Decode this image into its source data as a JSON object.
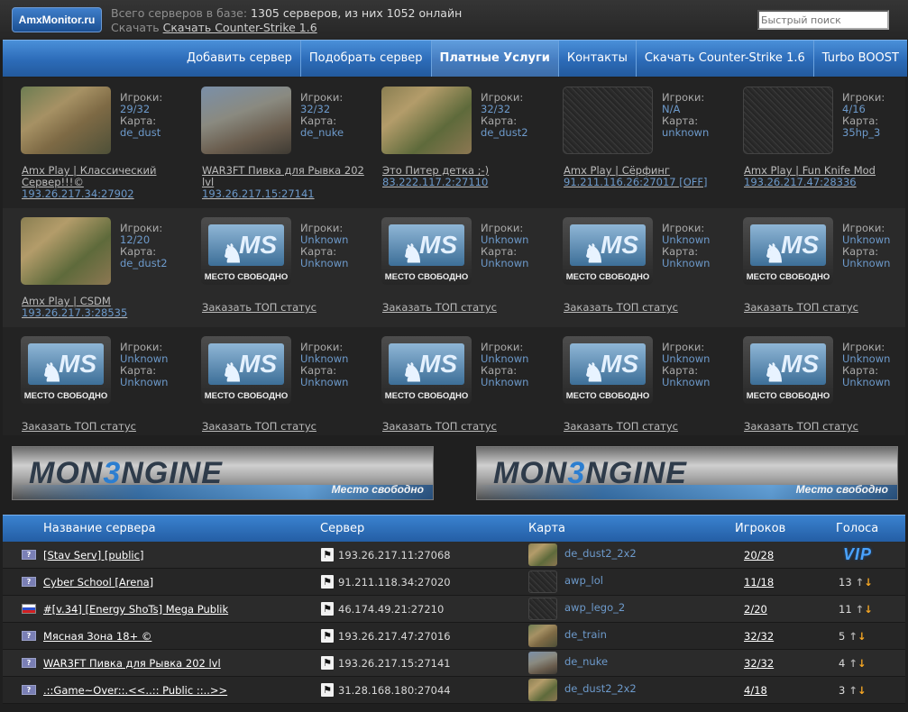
{
  "header": {
    "logo": "AmxMonitor.ru",
    "stats_prefix": "Всего серверов в базе:",
    "stats_value": "1305 серверов, из них 1052 онлайн",
    "download_prefix": "Скачать",
    "download_link": "Скачать Counter-Strike 1.6",
    "search_placeholder": "Быстрый поиск"
  },
  "nav": [
    "Добавить сервер",
    "Подобрать сервер",
    "Платные Услуги",
    "Контакты",
    "Скачать Counter-Strike 1.6",
    "Turbo BOOST"
  ],
  "labels": {
    "players": "Игроки:",
    "map": "Карта:",
    "free_slot": "МЕСТО СВОБОДНО",
    "order_top": "Заказать ТОП статус"
  },
  "top_servers": [
    {
      "players": "29/32",
      "map": "de_dust",
      "name": "Amx Play | Классический Сервер!!!©",
      "addr": "193.26.217.34:27902",
      "thumb": "map"
    },
    {
      "players": "32/32",
      "map": "de_nuke",
      "name": "WAR3FT Пивка для Рывка 202 lvl",
      "addr": "193.26.217.15:27141",
      "thumb": "nuke"
    },
    {
      "players": "32/32",
      "map": "de_dust2",
      "name": "Это Питер детка ;-)",
      "addr": "83.222.117.2:27110",
      "thumb": "dust"
    },
    {
      "players": "N/A",
      "map": "unknown",
      "name": "Amx Play | Сёрфинг",
      "addr": "91.211.116.26:27017 [OFF]",
      "thumb": "noise"
    },
    {
      "players": "4/16",
      "map": "35hp_3",
      "name": "Amx Play | Fun Knife Mod",
      "addr": "193.26.217.47:28336",
      "thumb": "noise"
    },
    {
      "players": "12/20",
      "map": "de_dust2",
      "name": "Amx Play | CSDM",
      "addr": "193.26.217.3:28535",
      "thumb": "dust"
    }
  ],
  "free_values": {
    "players": "Unknown",
    "map": "Unknown"
  },
  "banners": {
    "word_a": "MON",
    "word_b": "3",
    "word_c": "NGINE",
    "free": "Место свободно"
  },
  "table": {
    "headers": {
      "name": "Название сервера",
      "server": "Сервер",
      "map": "Карта",
      "players": "Игроков",
      "votes": "Голоса"
    },
    "rows": [
      {
        "flag": "?",
        "name": "[Stav Serv] [public]",
        "server": "193.26.217.11:27068",
        "map": "de_dust2_2x2",
        "players": "20/28",
        "votes": "VIP"
      },
      {
        "flag": "?",
        "name": "Cyber School [Arena]",
        "server": "91.211.118.34:27020",
        "map": "awp_lol",
        "players": "11/18",
        "votes": "13"
      },
      {
        "flag": "ru",
        "name": "#[v.34] [Energy ShoTs] Mega Publik",
        "server": "46.174.49.21:27210",
        "map": "awp_lego_2",
        "players": "2/20",
        "votes": "11"
      },
      {
        "flag": "?",
        "name": "Мясная Зона 18+ ©",
        "server": "193.26.217.47:27016",
        "map": "de_train",
        "players": "32/32",
        "votes": "5"
      },
      {
        "flag": "?",
        "name": "WAR3FT Пивка для Рывка 202 lvl",
        "server": "193.26.217.15:27141",
        "map": "de_nuke",
        "players": "32/32",
        "votes": "4"
      },
      {
        "flag": "?",
        "name": ".::Game~Over::.<<..:: Public ::..>>",
        "server": "31.28.168.180:27044",
        "map": "de_dust2_2x2",
        "players": "4/18",
        "votes": "3"
      }
    ]
  },
  "colors": {
    "accent": "#2c6bb8",
    "link": "#6d9acb",
    "vote_down": "#f5a623"
  }
}
